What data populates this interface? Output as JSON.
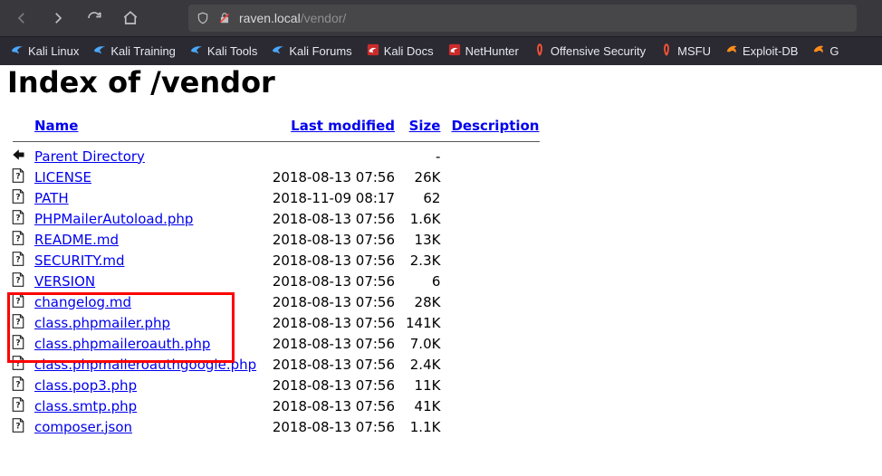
{
  "browser": {
    "url_host": "raven.local",
    "url_path": "/vendor/"
  },
  "bookmarks": [
    {
      "label": "Kali Linux",
      "icon": "kali"
    },
    {
      "label": "Kali Training",
      "icon": "kali"
    },
    {
      "label": "Kali Tools",
      "icon": "kali"
    },
    {
      "label": "Kali Forums",
      "icon": "kali"
    },
    {
      "label": "Kali Docs",
      "icon": "kali-red"
    },
    {
      "label": "NetHunter",
      "icon": "kali-red"
    },
    {
      "label": "Offensive Security",
      "icon": "offsec"
    },
    {
      "label": "MSFU",
      "icon": "offsec"
    },
    {
      "label": "Exploit-DB",
      "icon": "edb"
    },
    {
      "label": "G",
      "icon": "edb"
    }
  ],
  "heading": "Index of /vendor",
  "columns": {
    "name": "Name",
    "modified": "Last modified",
    "size": "Size",
    "desc": "Description"
  },
  "rows": [
    {
      "icon": "back",
      "name": "Parent Directory",
      "date": "",
      "size": "-",
      "visited": false
    },
    {
      "icon": "file",
      "name": "LICENSE",
      "date": "2018-08-13 07:56",
      "size": "26K",
      "visited": false
    },
    {
      "icon": "file",
      "name": "PATH",
      "date": "2018-11-09 08:17",
      "size": "62",
      "visited": true
    },
    {
      "icon": "file",
      "name": "PHPMailerAutoload.php",
      "date": "2018-08-13 07:56",
      "size": "1.6K",
      "visited": false
    },
    {
      "icon": "file",
      "name": "README.md",
      "date": "2018-08-13 07:56",
      "size": "13K",
      "visited": false
    },
    {
      "icon": "file",
      "name": "SECURITY.md",
      "date": "2018-08-13 07:56",
      "size": "2.3K",
      "visited": false
    },
    {
      "icon": "file",
      "name": "VERSION",
      "date": "2018-08-13 07:56",
      "size": "6",
      "visited": false
    },
    {
      "icon": "file",
      "name": "changelog.md",
      "date": "2018-08-13 07:56",
      "size": "28K",
      "visited": false
    },
    {
      "icon": "file",
      "name": "class.phpmailer.php",
      "date": "2018-08-13 07:56",
      "size": "141K",
      "visited": false
    },
    {
      "icon": "file",
      "name": "class.phpmaileroauth.php",
      "date": "2018-08-13 07:56",
      "size": "7.0K",
      "visited": false
    },
    {
      "icon": "file",
      "name": "class.phpmaileroauthgoogle.php",
      "date": "2018-08-13 07:56",
      "size": "2.4K",
      "visited": false
    },
    {
      "icon": "file",
      "name": "class.pop3.php",
      "date": "2018-08-13 07:56",
      "size": "11K",
      "visited": false
    },
    {
      "icon": "file",
      "name": "class.smtp.php",
      "date": "2018-08-13 07:56",
      "size": "41K",
      "visited": false
    },
    {
      "icon": "file",
      "name": "composer.json",
      "date": "2018-08-13 07:56",
      "size": "1.1K",
      "visited": false
    }
  ]
}
